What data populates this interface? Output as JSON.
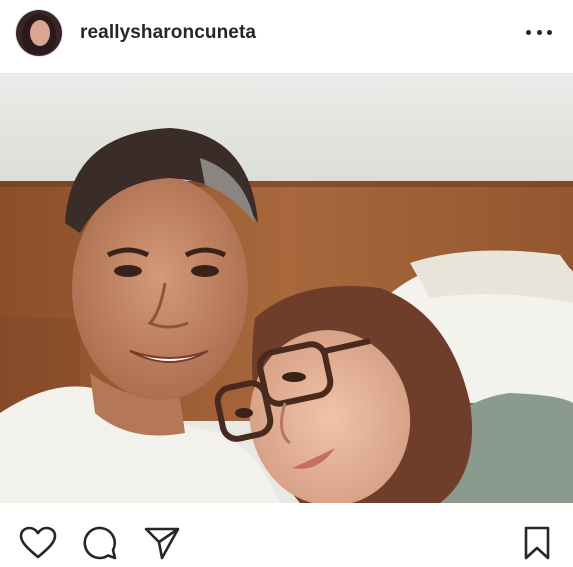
{
  "post": {
    "username": "reallysharoncuneta",
    "avatar_icon": "profile-avatar",
    "more_icon": "more-options-icon",
    "photo_description_icon": "post-photo"
  },
  "actions": {
    "like_icon": "heart-icon",
    "comment_icon": "comment-icon",
    "share_icon": "share-icon",
    "save_icon": "bookmark-icon"
  },
  "colors": {
    "text": "#262626",
    "background": "#ffffff"
  }
}
